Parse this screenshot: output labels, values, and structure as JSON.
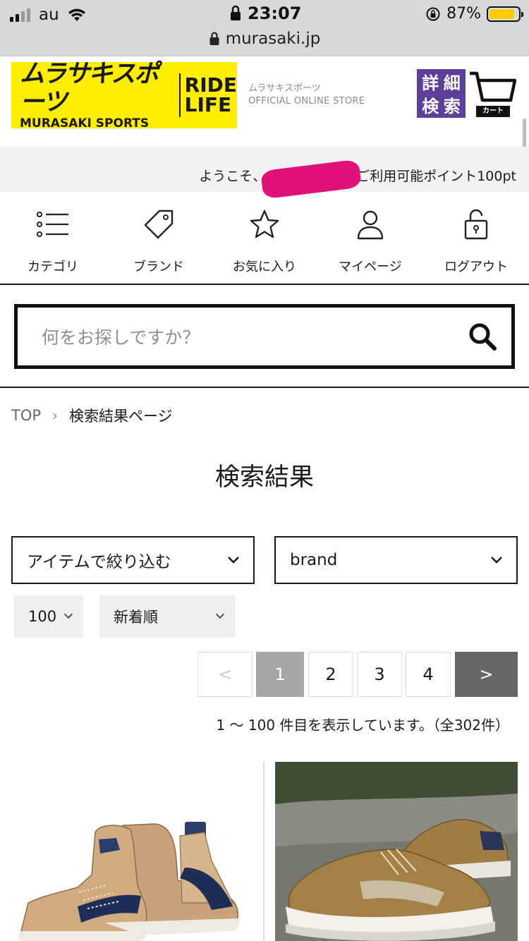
{
  "status_bar": {
    "carrier": "au",
    "time": "23:07",
    "battery_percent": "87%",
    "battery_level": 0.87,
    "url": "murasaki.jp"
  },
  "header": {
    "logo_jp": "ムラサキスポーツ",
    "logo_en": "MURASAKI SPORTS",
    "logo_tagline_1": "RIDE",
    "logo_tagline_2": "LIFE",
    "store_name_jp": "ムラサキスポーツ",
    "store_name_en": "OFFICIAL ONLINE STORE",
    "advanced_search": [
      "詳",
      "細",
      "検",
      "索"
    ],
    "cart_label": "カート"
  },
  "welcome": {
    "prefix": "ようこそ、",
    "suffix": "ご利用可能ポイント100pt"
  },
  "nav": {
    "items": [
      {
        "label": "カテゴリ",
        "icon": "list-icon"
      },
      {
        "label": "ブランド",
        "icon": "tag-icon"
      },
      {
        "label": "お気に入り",
        "icon": "star-icon"
      },
      {
        "label": "マイページ",
        "icon": "user-icon"
      },
      {
        "label": "ログアウト",
        "icon": "unlock-icon"
      }
    ]
  },
  "search": {
    "placeholder": "何をお探しですか？"
  },
  "breadcrumb": {
    "root": "TOP",
    "separator": "›",
    "current": "検索結果ページ"
  },
  "page_title": "検索結果",
  "filters": {
    "item_filter": "アイテムで絞り込む",
    "brand_filter": "brand",
    "per_page": "100",
    "sort": "新着順"
  },
  "pagination": {
    "prev": "<",
    "pages": [
      "1",
      "2",
      "3",
      "4"
    ],
    "active_page": "1",
    "next": ">"
  },
  "results_text": "1 〜 100 件目を表示しています。（全302件）",
  "colors": {
    "brand_yellow": "#ffee00",
    "purple": "#5b3f98",
    "redaction": "#e0127a"
  }
}
